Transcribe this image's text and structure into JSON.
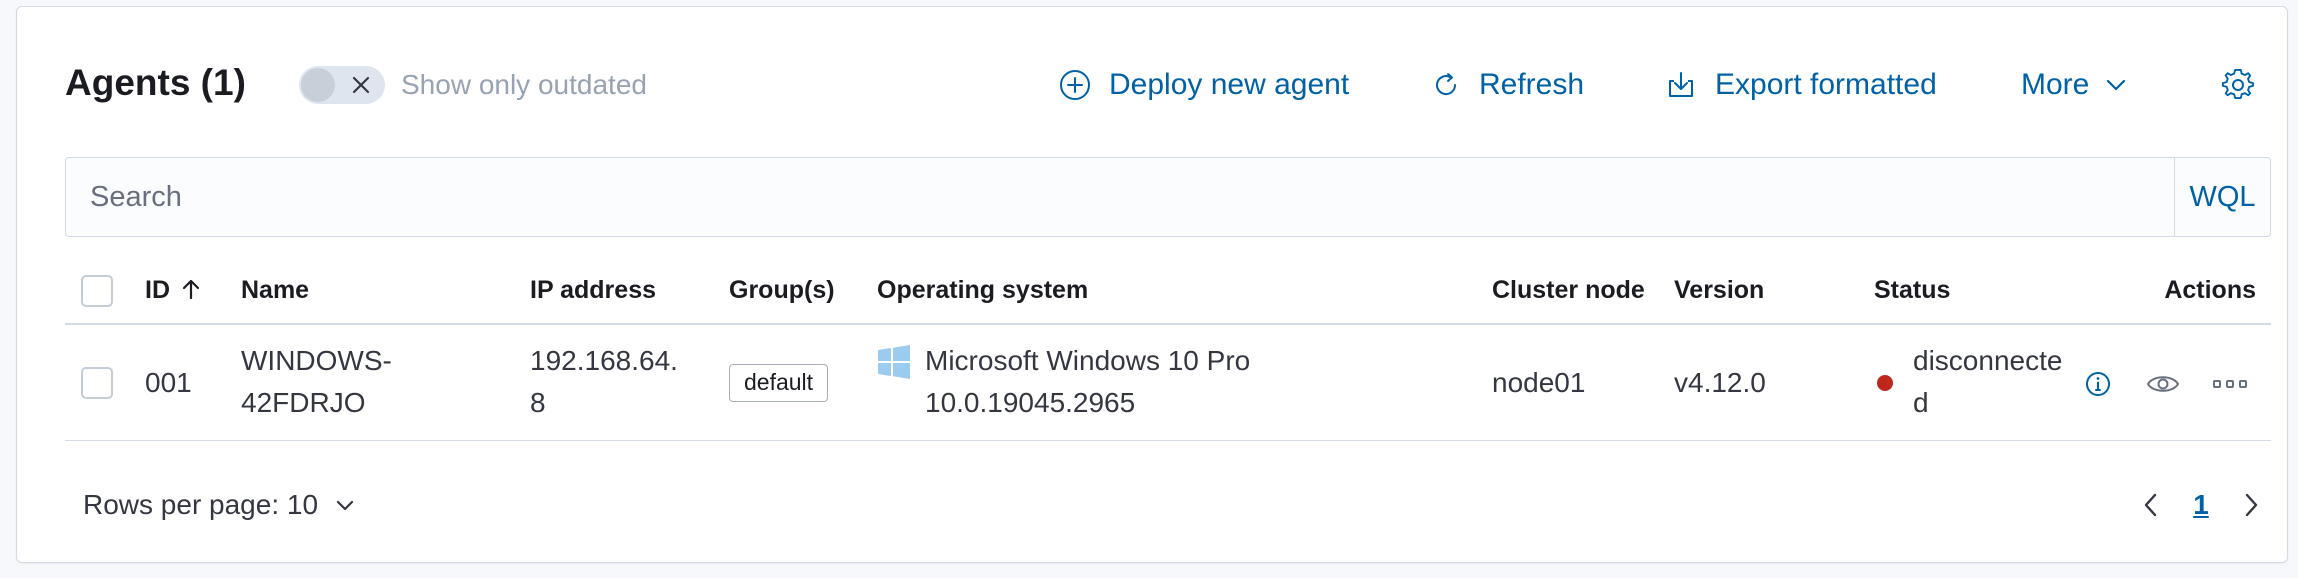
{
  "header": {
    "title": "Agents (1)",
    "outdated_toggle_label": "Show only outdated",
    "outdated_toggle_on": false,
    "deploy_label": "Deploy new agent",
    "refresh_label": "Refresh",
    "export_label": "Export formatted",
    "more_label": "More"
  },
  "search": {
    "placeholder": "Search",
    "value": "",
    "query_language": "WQL"
  },
  "table": {
    "columns": {
      "id": "ID",
      "name": "Name",
      "ip": "IP address",
      "groups": "Group(s)",
      "os": "Operating system",
      "cluster_node": "Cluster node",
      "version": "Version",
      "status": "Status",
      "actions": "Actions"
    },
    "sort": {
      "column": "ID",
      "direction": "ascending"
    },
    "rows": [
      {
        "id": "001",
        "name_line1": "WINDOWS-",
        "name_line2": "42FDRJO",
        "ip_line1": "192.168.64.",
        "ip_line2": "8",
        "group": "default",
        "os_icon": "windows-logo-icon",
        "os_line1": "Microsoft Windows 10 Pro",
        "os_line2": "10.0.19045.2965",
        "cluster_node": "node01",
        "version": "v4.12.0",
        "status_line1": "disconnecte",
        "status_line2": "d",
        "status_color": "#bd271e"
      }
    ]
  },
  "footer": {
    "rows_per_page_label": "Rows per page: 10",
    "current_page": "1"
  },
  "colors": {
    "accent": "#0061a6",
    "status_disconnected": "#bd271e",
    "windows_logo": "#9ccbf0"
  }
}
